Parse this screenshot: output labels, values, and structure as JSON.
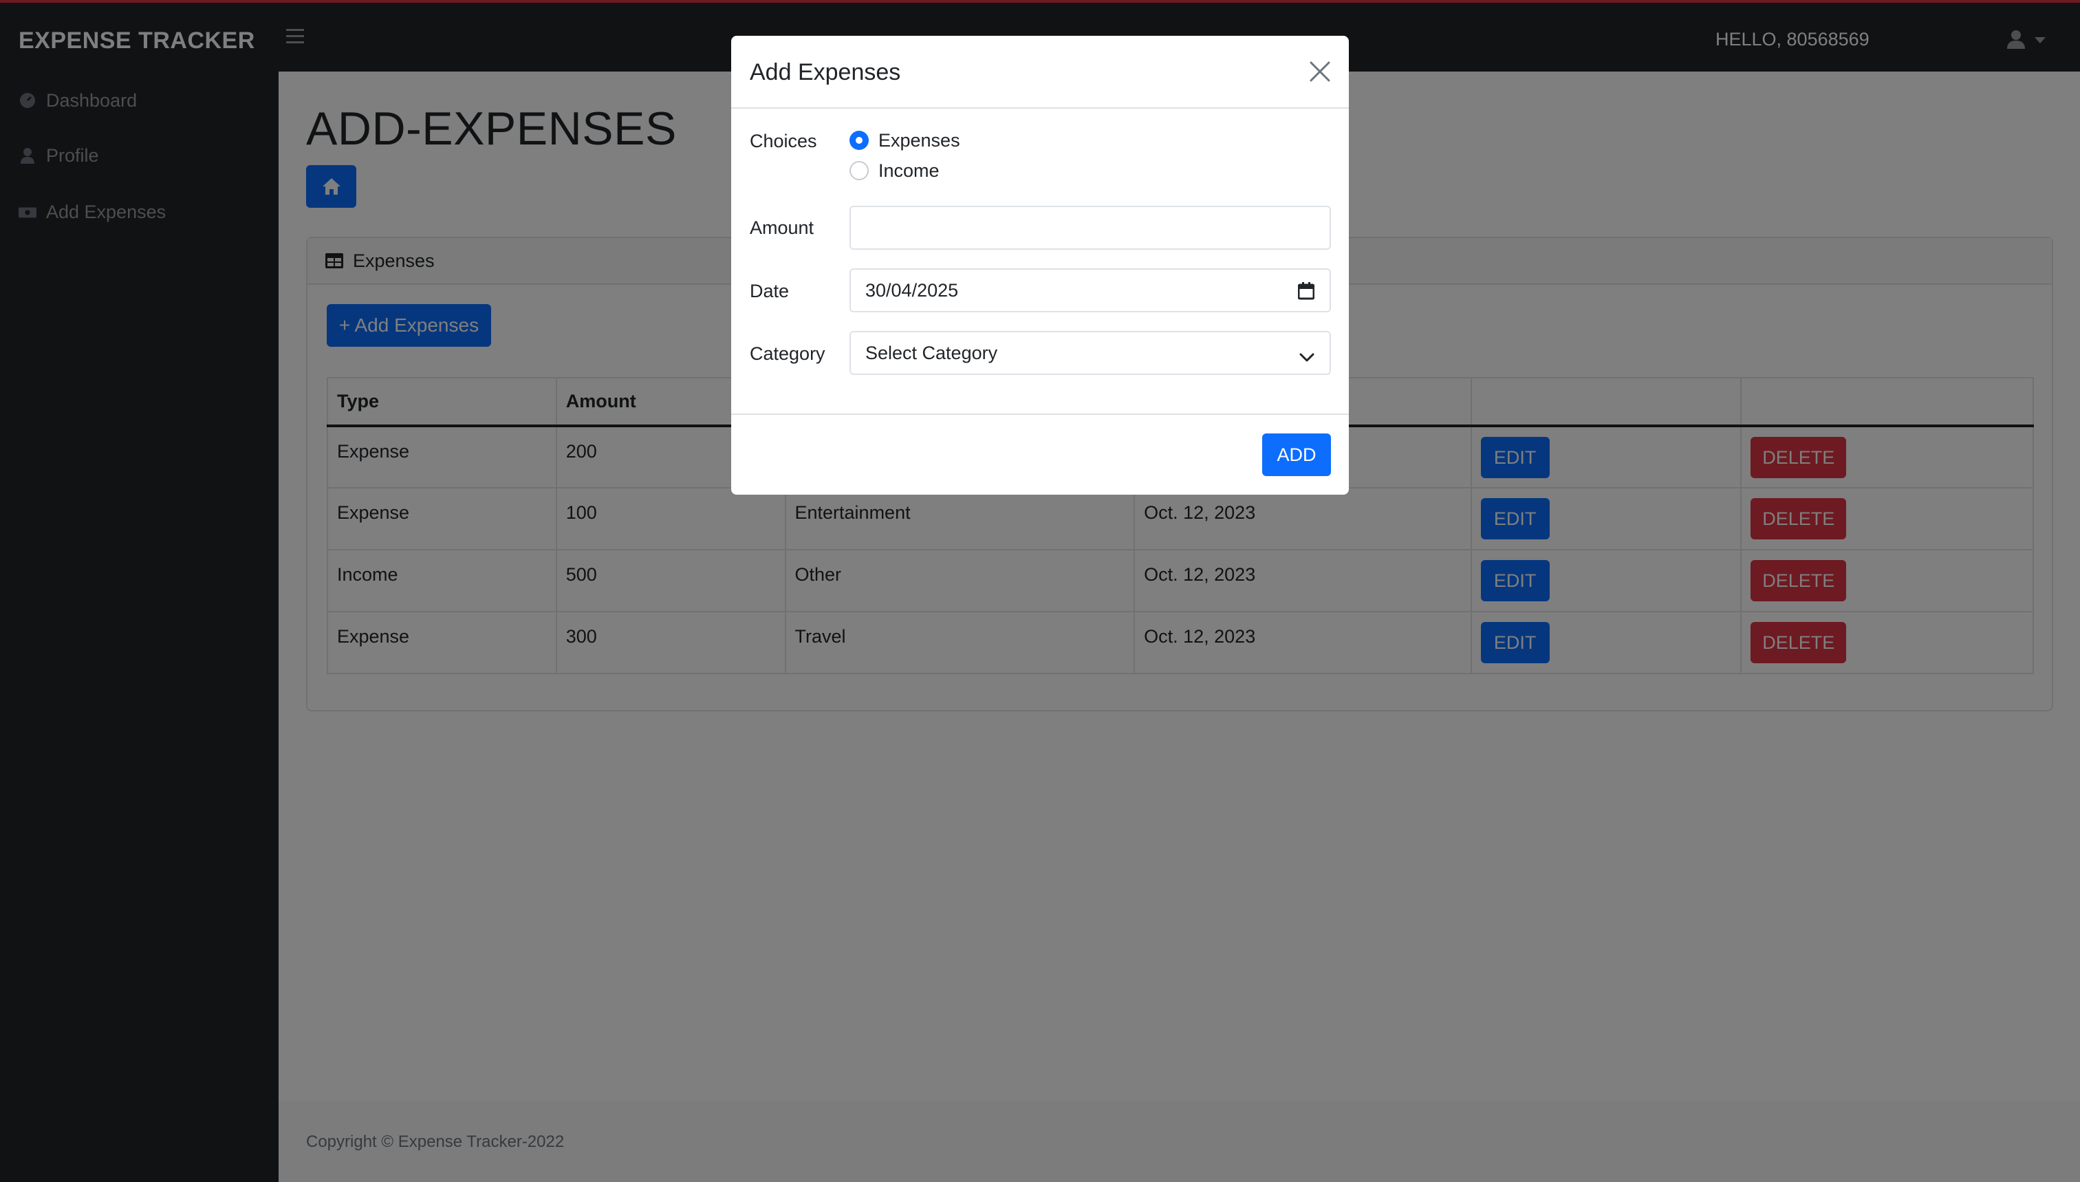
{
  "app": {
    "brand": "EXPENSE TRACKER",
    "greeting": "HELLO, 80568569"
  },
  "sidebar": {
    "items": [
      {
        "label": "Dashboard",
        "icon": "gauge-icon"
      },
      {
        "label": "Profile",
        "icon": "user-icon"
      },
      {
        "label": "Add Expenses",
        "icon": "money-icon"
      }
    ]
  },
  "main": {
    "title": "ADD-EXPENSES",
    "card_title": "Expenses",
    "add_button": "+ Add Expenses",
    "table": {
      "headers": [
        "Type",
        "Amount",
        "",
        "",
        "",
        ""
      ],
      "rows": [
        {
          "type": "Expense",
          "amount": "200",
          "category": "",
          "date": "",
          "edit": "EDIT",
          "delete": "DELETE"
        },
        {
          "type": "Expense",
          "amount": "100",
          "category": "Entertainment",
          "date": "Oct. 12, 2023",
          "edit": "EDIT",
          "delete": "DELETE"
        },
        {
          "type": "Income",
          "amount": "500",
          "category": "Other",
          "date": "Oct. 12, 2023",
          "edit": "EDIT",
          "delete": "DELETE"
        },
        {
          "type": "Expense",
          "amount": "300",
          "category": "Travel",
          "date": "Oct. 12, 2023",
          "edit": "EDIT",
          "delete": "DELETE"
        }
      ]
    }
  },
  "footer": {
    "text": "Copyright © Expense Tracker-2022"
  },
  "modal": {
    "title": "Add Expenses",
    "choices_label": "Choices",
    "choice_expenses": "Expenses",
    "choice_income": "Income",
    "selected_choice": "Expenses",
    "amount_label": "Amount",
    "amount_value": "",
    "date_label": "Date",
    "date_value": "30/04/2025",
    "category_label": "Category",
    "category_value": "Select Category",
    "submit": "ADD"
  },
  "colors": {
    "primary": "#0d6efd",
    "danger": "#dc3545",
    "dark": "#212529"
  }
}
